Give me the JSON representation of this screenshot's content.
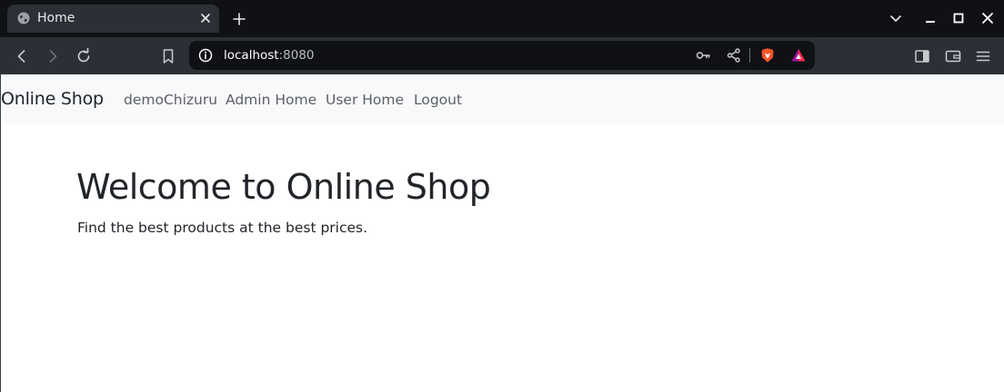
{
  "browser": {
    "tab": {
      "title": "Home"
    },
    "address_bar": {
      "host": "localhost",
      "port": ":8080"
    }
  },
  "navbar": {
    "brand": "Online Shop",
    "links": [
      {
        "label": "demoChizuru"
      },
      {
        "label": "Admin Home"
      },
      {
        "label": "User Home"
      },
      {
        "label": "Logout"
      }
    ]
  },
  "hero": {
    "title": "Welcome to Online Shop",
    "lead": "Find the best products at the best prices."
  },
  "colors": {
    "tabstrip_bg": "#0f1115",
    "toolbar_bg": "#2c2f36",
    "navbar_bg": "#f8f9fa",
    "brave_orange": "#fb542b"
  }
}
